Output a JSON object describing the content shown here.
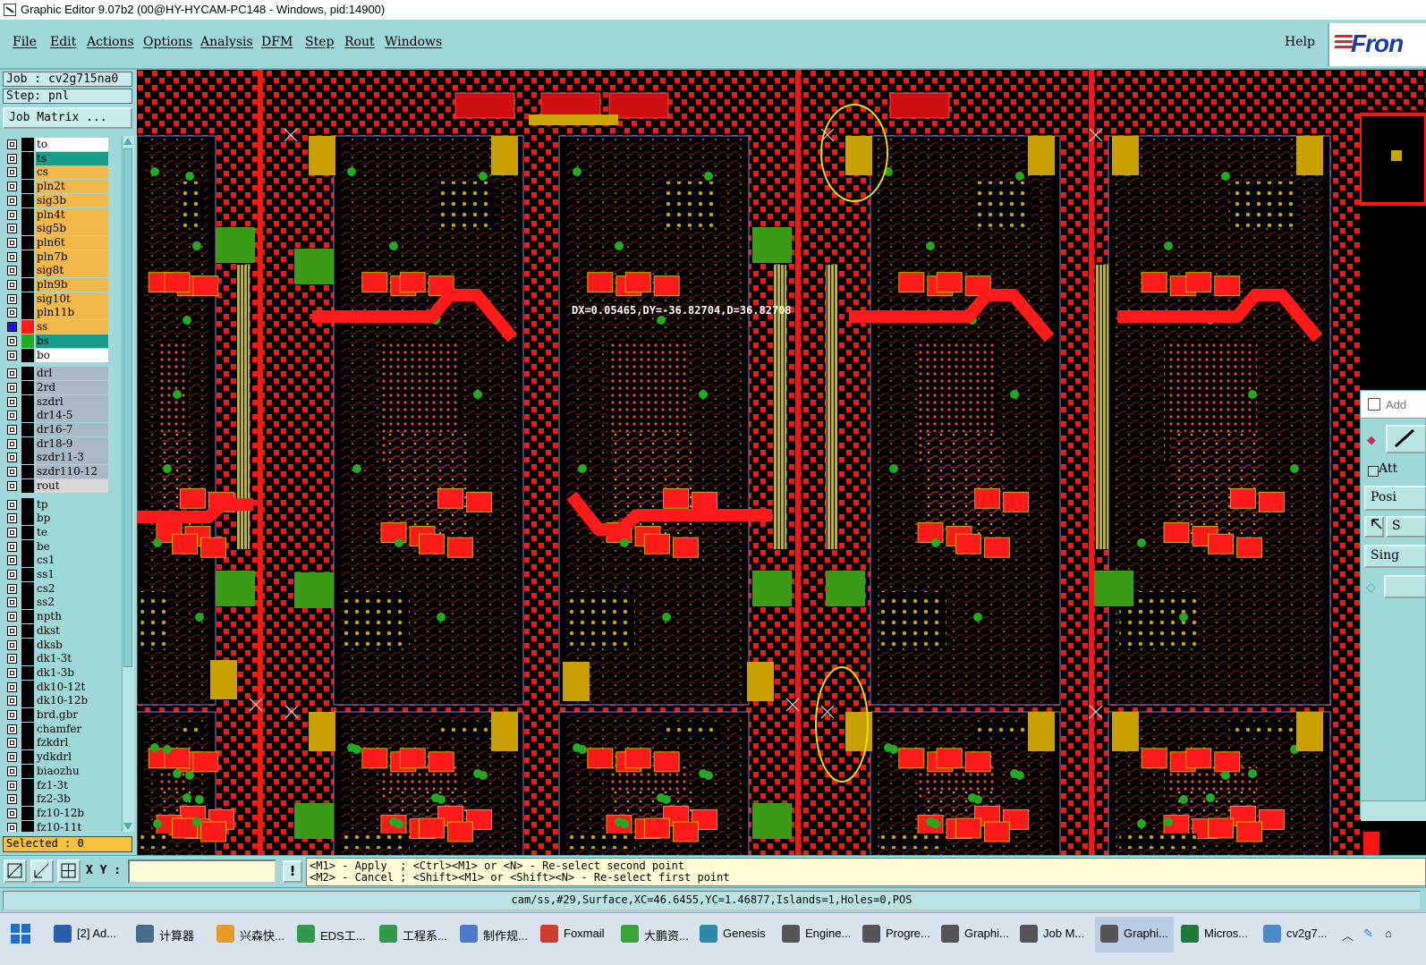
{
  "window": {
    "title": "Graphic Editor 9.07b2 (00@HY-HYCAM-PC148 - Windows, pid:14900)"
  },
  "menu": {
    "items": [
      "File",
      "Edit",
      "Actions",
      "Options",
      "Analysis",
      "DFM",
      "Step",
      "Rout",
      "Windows"
    ],
    "help": "Help",
    "logo_text": "Fron"
  },
  "panel": {
    "job": "Job : cv2g715na0",
    "step": "Step: pnl",
    "job_matrix": "Job Matrix ...",
    "selected": "Selected : 0"
  },
  "layers": [
    {
      "name": "to",
      "color": "#ffffff",
      "swatch": "#000000"
    },
    {
      "name": "ts",
      "color": "#1a9c8c",
      "swatch": "#000000"
    },
    {
      "name": "cs",
      "color": "#f2b84a",
      "swatch": "#000000"
    },
    {
      "name": "pln2t",
      "color": "#f2b84a",
      "swatch": "#000000"
    },
    {
      "name": "sig3b",
      "color": "#f2b84a",
      "swatch": "#000000"
    },
    {
      "name": "pln4t",
      "color": "#f2b84a",
      "swatch": "#000000"
    },
    {
      "name": "sig5b",
      "color": "#f2b84a",
      "swatch": "#000000"
    },
    {
      "name": "pln6t",
      "color": "#f2b84a",
      "swatch": "#000000"
    },
    {
      "name": "pln7b",
      "color": "#f2b84a",
      "swatch": "#000000"
    },
    {
      "name": "sig8t",
      "color": "#f2b84a",
      "swatch": "#000000"
    },
    {
      "name": "pln9b",
      "color": "#f2b84a",
      "swatch": "#000000"
    },
    {
      "name": "sig10t",
      "color": "#f2b84a",
      "swatch": "#000000"
    },
    {
      "name": "pln11b",
      "color": "#f2b84a",
      "swatch": "#000000"
    },
    {
      "name": "ss",
      "color": "#f2b84a",
      "swatch": "#ff1a1a",
      "active": true
    },
    {
      "name": "bs",
      "color": "#1a9c8c",
      "swatch": "#22aa22"
    },
    {
      "name": "bo",
      "color": "#ffffff",
      "swatch": "#000000"
    },
    {
      "name": "drl",
      "color": "#a8b8c4",
      "swatch": "#000000",
      "gap": true
    },
    {
      "name": "2rd",
      "color": "#a8b8c4",
      "swatch": "#000000"
    },
    {
      "name": "szdrl",
      "color": "#a8b8c4",
      "swatch": "#000000"
    },
    {
      "name": "dr14-5",
      "color": "#a8b8c4",
      "swatch": "#000000"
    },
    {
      "name": "dr16-7",
      "color": "#a8b8c4",
      "swatch": "#000000"
    },
    {
      "name": "dr18-9",
      "color": "#a8b8c4",
      "swatch": "#000000"
    },
    {
      "name": "szdr11-3",
      "color": "#a8b8c4",
      "swatch": "#000000"
    },
    {
      "name": "szdr110-12",
      "color": "#a8b8c4",
      "swatch": "#000000"
    },
    {
      "name": "rout",
      "color": "#d8d8d8",
      "swatch": "#000000"
    },
    {
      "name": "tp",
      "color": "#9fd8d8",
      "swatch": "#000000",
      "gap": true
    },
    {
      "name": "bp",
      "color": "#9fd8d8",
      "swatch": "#000000"
    },
    {
      "name": "te",
      "color": "#9fd8d8",
      "swatch": "#000000"
    },
    {
      "name": "be",
      "color": "#9fd8d8",
      "swatch": "#000000"
    },
    {
      "name": "cs1",
      "color": "#9fd8d8",
      "swatch": "#000000"
    },
    {
      "name": "ss1",
      "color": "#9fd8d8",
      "swatch": "#000000"
    },
    {
      "name": "cs2",
      "color": "#9fd8d8",
      "swatch": "#000000"
    },
    {
      "name": "ss2",
      "color": "#9fd8d8",
      "swatch": "#000000"
    },
    {
      "name": "npth",
      "color": "#9fd8d8",
      "swatch": "#000000"
    },
    {
      "name": "dkst",
      "color": "#9fd8d8",
      "swatch": "#000000"
    },
    {
      "name": "dksb",
      "color": "#9fd8d8",
      "swatch": "#000000"
    },
    {
      "name": "dk1-3t",
      "color": "#9fd8d8",
      "swatch": "#000000"
    },
    {
      "name": "dk1-3b",
      "color": "#9fd8d8",
      "swatch": "#000000"
    },
    {
      "name": "dk10-12t",
      "color": "#9fd8d8",
      "swatch": "#000000"
    },
    {
      "name": "dk10-12b",
      "color": "#9fd8d8",
      "swatch": "#000000"
    },
    {
      "name": "brd.gbr",
      "color": "#9fd8d8",
      "swatch": "#000000"
    },
    {
      "name": "chamfer",
      "color": "#9fd8d8",
      "swatch": "#000000"
    },
    {
      "name": "fzkdrl",
      "color": "#9fd8d8",
      "swatch": "#000000"
    },
    {
      "name": "ydkdrl",
      "color": "#9fd8d8",
      "swatch": "#000000"
    },
    {
      "name": "biaozhu",
      "color": "#9fd8d8",
      "swatch": "#000000"
    },
    {
      "name": "fz1-3t",
      "color": "#9fd8d8",
      "swatch": "#000000"
    },
    {
      "name": "fz2-3b",
      "color": "#9fd8d8",
      "swatch": "#000000"
    },
    {
      "name": "fz10-12b",
      "color": "#9fd8d8",
      "swatch": "#000000"
    },
    {
      "name": "fz10-11t",
      "color": "#9fd8d8",
      "swatch": "#000000"
    }
  ],
  "canvas": {
    "measure": "DX=0.05465,DY=-36.82704,D=36.82708"
  },
  "right_dialog": {
    "title": "Add",
    "attr": "Att",
    "position": "Posi",
    "s": "S",
    "single": "Sing"
  },
  "bottom": {
    "xy_label": "X Y :",
    "xy_value": "",
    "bang": "!",
    "hint1": "<M1> - Apply  ; <Ctrl><M1> or <N> - Re-select second point",
    "hint2": "<M2> - Cancel ; <Shift><M1> or <Shift><N> - Re-select first point",
    "status": "cam/ss,#29,Surface,XC=46.6455,YC=1.46877,Islands=1,Holes=0,POS"
  },
  "taskbar": [
    {
      "label": "[2] Ad...",
      "icon": "save-icon",
      "color": "#2a5db0"
    },
    {
      "label": "计算器",
      "icon": "calculator-icon",
      "color": "#4a6a8a"
    },
    {
      "label": "兴森快...",
      "icon": "app-icon",
      "color": "#e69a28"
    },
    {
      "label": "EDS工...",
      "icon": "app-icon",
      "color": "#2e9a4a"
    },
    {
      "label": "工程系...",
      "icon": "app-icon",
      "color": "#2e9a4a"
    },
    {
      "label": "制作规...",
      "icon": "document-icon",
      "color": "#4a7ac8"
    },
    {
      "label": "Foxmail",
      "icon": "mail-icon",
      "color": "#d23c2c"
    },
    {
      "label": "大鹏资...",
      "icon": "app-icon",
      "color": "#3aa43a"
    },
    {
      "label": "Genesis",
      "icon": "app-icon",
      "color": "#2a8aa8"
    },
    {
      "label": "Engine...",
      "icon": "window-icon",
      "color": "#555555"
    },
    {
      "label": "Progre...",
      "icon": "window-icon",
      "color": "#555555"
    },
    {
      "label": "Graphi...",
      "icon": "window-icon",
      "color": "#555555"
    },
    {
      "label": "Job M...",
      "icon": "window-icon",
      "color": "#555555"
    },
    {
      "label": "Graphi...",
      "icon": "window-icon",
      "color": "#555555",
      "active": true
    },
    {
      "label": "Micros...",
      "icon": "excel-icon",
      "color": "#1e7a3c"
    },
    {
      "label": "cv2g7...",
      "icon": "app-icon",
      "color": "#4a8ac8"
    }
  ]
}
